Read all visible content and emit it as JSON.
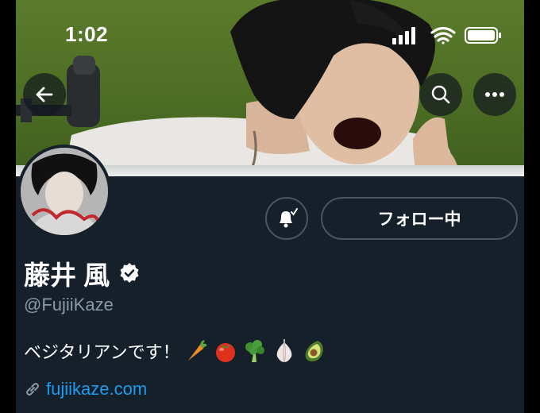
{
  "status_bar": {
    "time": "1:02",
    "icons": [
      "signal-icon",
      "wifi-icon",
      "battery-icon"
    ]
  },
  "nav": {
    "back_icon": "back-arrow-icon",
    "search_icon": "search-icon",
    "more_icon": "more-icon"
  },
  "profile": {
    "display_name": "藤井 風",
    "verified": true,
    "handle": "@FujiiKaze",
    "bio": "ベジタリアンです！",
    "bio_emojis": [
      "carrot",
      "tomato",
      "broccoli",
      "garlic",
      "avocado"
    ],
    "link": "fujiikaze.com",
    "link_icon": "link-icon"
  },
  "actions": {
    "notify_icon": "bell-notification-icon",
    "follow_label": "フォロー中"
  },
  "colors": {
    "background": "#15202b",
    "accent_link": "#1d9bf0",
    "muted_text": "#8b98a5",
    "button_border": "#4b5560"
  }
}
